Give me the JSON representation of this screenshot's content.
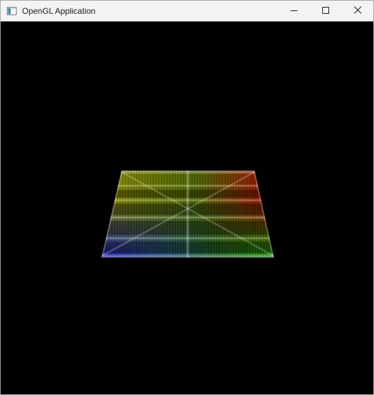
{
  "window": {
    "title": "OpenGL Application",
    "icons": {
      "app": "app-window-icon",
      "minimize": "minimize-icon",
      "maximize": "maximize-icon",
      "close": "close-icon"
    }
  },
  "scene": {
    "background": "#000000",
    "object": "textured-quad",
    "vertex_colors": {
      "top_left": "#a0a000",
      "top_right": "#c00000",
      "bottom_left": "#1010d0",
      "bottom_right": "#00b000"
    }
  }
}
